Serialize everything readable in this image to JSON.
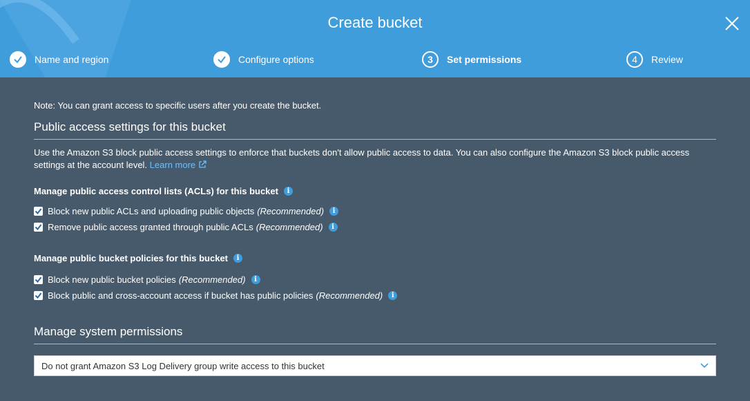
{
  "header": {
    "title": "Create bucket",
    "steps": [
      {
        "number": "1",
        "label": "Name and region",
        "status": "complete"
      },
      {
        "number": "2",
        "label": "Configure options",
        "status": "complete"
      },
      {
        "number": "3",
        "label": "Set permissions",
        "status": "active"
      },
      {
        "number": "4",
        "label": "Review",
        "status": "pending"
      }
    ]
  },
  "content": {
    "note": "Note: You can grant access to specific users after you create the bucket.",
    "public_access": {
      "title": "Public access settings for this bucket",
      "description": "Use the Amazon S3 block public access settings to enforce that buckets don't allow public access to data. You can also configure the Amazon S3 block public access settings at the account level.",
      "learn_more": "Learn more"
    },
    "acl_group": {
      "heading": "Manage public access control lists (ACLs) for this bucket",
      "options": [
        {
          "label": "Block new public ACLs and uploading public objects",
          "note": "(Recommended)",
          "checked": true
        },
        {
          "label": "Remove public access granted through public ACLs",
          "note": "(Recommended)",
          "checked": true
        }
      ]
    },
    "policy_group": {
      "heading": "Manage public bucket policies for this bucket",
      "options": [
        {
          "label": "Block new public bucket policies",
          "note": "(Recommended)",
          "checked": true
        },
        {
          "label": "Block public and cross-account access if bucket has public policies",
          "note": "(Recommended)",
          "checked": true
        }
      ]
    },
    "system_permissions": {
      "title": "Manage system permissions",
      "selected": "Do not grant Amazon S3 Log Delivery group write access to this bucket"
    }
  },
  "colors": {
    "header": "#3f9ddc",
    "body": "#475a6b",
    "accent": "#3f9ddc",
    "link": "#6cc0ff"
  }
}
